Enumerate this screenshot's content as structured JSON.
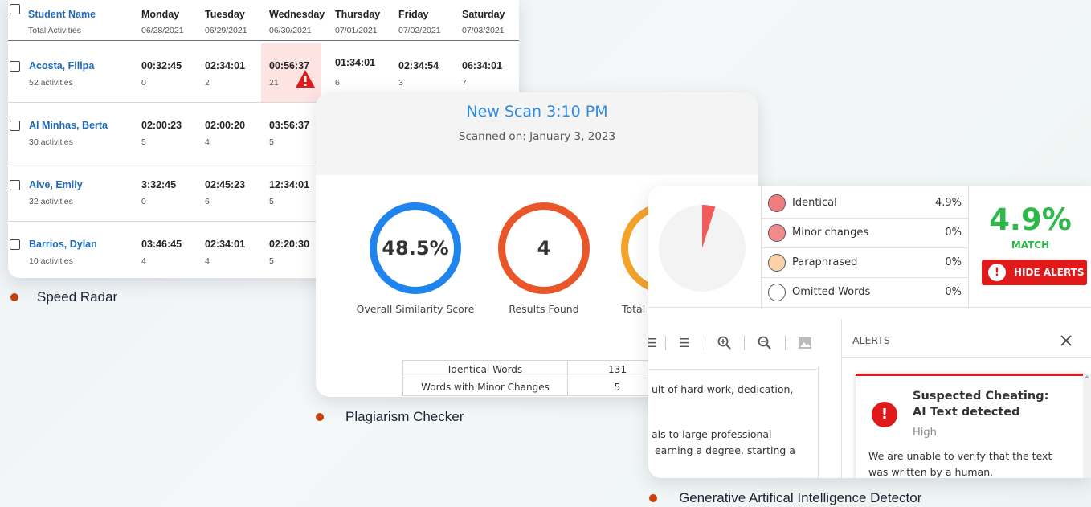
{
  "speed_radar": {
    "header": {
      "name_label": "Student Name",
      "sub_label": "Total Activities",
      "days": [
        {
          "day": "Monday",
          "date": "06/28/2021"
        },
        {
          "day": "Tuesday",
          "date": "06/29/2021"
        },
        {
          "day": "Wednesday",
          "date": "06/30/2021"
        },
        {
          "day": "Thursday",
          "date": "07/01/2021"
        },
        {
          "day": "Friday",
          "date": "07/02/2021"
        },
        {
          "day": "Saturday",
          "date": "07/03/2021"
        }
      ]
    },
    "rows": [
      {
        "name": "Acosta, Filipa",
        "activities": "52 activities",
        "times": [
          "00:32:45",
          "02:34:01",
          "00:56:37",
          "01:34:01",
          "02:34:54",
          "06:34:01"
        ],
        "counts": [
          "0",
          "2",
          "21",
          "6",
          "3",
          "7"
        ]
      },
      {
        "name": "Al Minhas, Berta",
        "activities": "30 activities",
        "times": [
          "02:00:23",
          "02:00:20",
          "03:56:37"
        ],
        "counts": [
          "5",
          "4",
          "5"
        ]
      },
      {
        "name": "Alve, Emily",
        "activities": "32 activities",
        "times": [
          "3:32:45",
          "02:45:23",
          "12:34:01"
        ],
        "counts": [
          "0",
          "6",
          "5"
        ]
      },
      {
        "name": "Barrios, Dylan",
        "activities": "10 activities",
        "times": [
          "03:46:45",
          "02:34:01",
          "02:20:30"
        ],
        "counts": [
          "4",
          "4",
          "5"
        ]
      }
    ],
    "flagged_color": "#fde3e1",
    "warning_icon": "warning-triangle-icon"
  },
  "plagiarism": {
    "title": "New Scan 3:10 PM",
    "subtitle": "Scanned on: January 3, 2023",
    "metrics": [
      {
        "value": "48.5%",
        "label": "Overall Similarity Score",
        "color": "#1f84ee"
      },
      {
        "value": "4",
        "label": "Results Found",
        "color": "#e8562a"
      },
      {
        "value": "",
        "label": "Total W",
        "color": "#f3a22a"
      }
    ],
    "table": [
      {
        "label": "Identical Words",
        "value": "131"
      },
      {
        "label": "Words with Minor Changes",
        "value": "5"
      }
    ]
  },
  "ai_detector": {
    "legend": [
      {
        "label": "Identical",
        "pct": "4.9%",
        "color": "#f07d7d"
      },
      {
        "label": "Minor changes",
        "pct": "0%",
        "color": "#f28b8b"
      },
      {
        "label": "Paraphrased",
        "pct": "0%",
        "color": "#fcd3a9"
      },
      {
        "label": "Omitted Words",
        "pct": "0%",
        "color": "#ffffff"
      }
    ],
    "match_value": "4.9%",
    "match_label": "MATCH",
    "match_color": "#2eb84a",
    "pie_fraction": 0.049,
    "hide_alerts_label": "HIDE ALERTS",
    "toolbar_icons": [
      "align-justify-icon",
      "align-right-icon",
      "zoom-in-icon",
      "zoom-out-icon",
      "image-icon"
    ],
    "doc_lines": [
      "ult of hard work, dedication,",
      "als to large professional",
      " earning a degree, starting a"
    ],
    "alerts_title": "ALERTS",
    "alert": {
      "title_line1": "Suspected Cheating:",
      "title_line2": "AI Text detected",
      "severity": "High",
      "body_line1": "We are unable to verify that the text",
      "body_line2": "was written by a human."
    }
  },
  "captions": {
    "speed": "Speed Radar",
    "plagiarism": "Plagiarism Checker",
    "ai": "Generative Artifical Intelligence Detector",
    "dot_color": "#c9400f"
  }
}
